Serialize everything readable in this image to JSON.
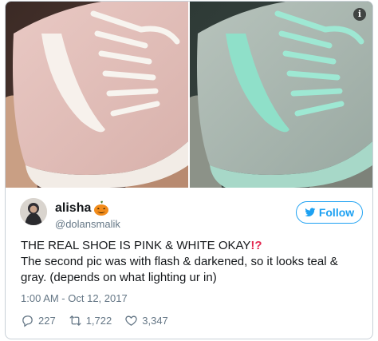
{
  "tweet": {
    "display_name": "alisha",
    "name_emoji": "pumpkin-icon",
    "handle": "@dolansmalik",
    "follow_label": "Follow",
    "text_line1": "THE REAL SHOE IS PINK & WHITE OKAY",
    "text_emphasis": "!?",
    "text_line2": "The second pic was with flash & darkened, so it looks teal & gray. (depends on what lighting ur in)",
    "timestamp": "1:00 AM - Oct 12, 2017",
    "replies": "227",
    "retweets": "1,722",
    "likes": "3,347"
  },
  "media": {
    "left_photo": "pink-white-shoe-photo",
    "right_photo": "teal-gray-shoe-photo",
    "info_icon": "info-icon"
  },
  "colors": {
    "accent": "#1da1f2",
    "secondary_text": "#657786",
    "emphasis": "#e3264f",
    "border": "#c9d1d8"
  }
}
